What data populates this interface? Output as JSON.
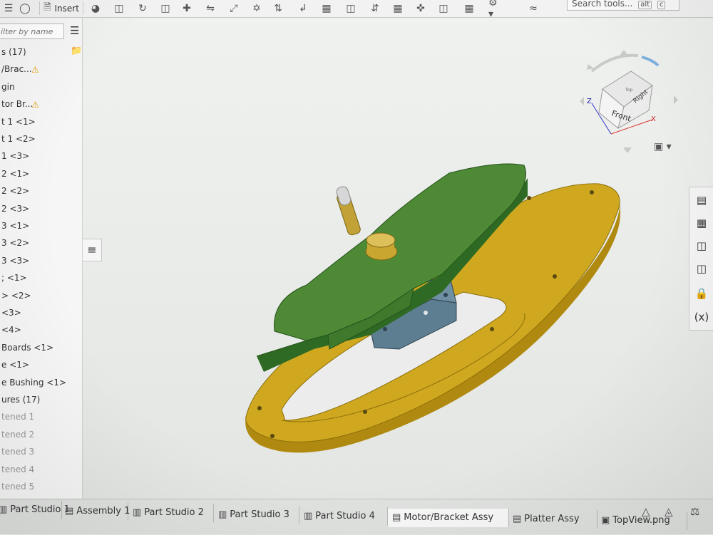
{
  "toolbar": {
    "insert_label": "Insert",
    "search_placeholder": "Search tools...",
    "search_shortcut_1": "alt",
    "search_shortcut_2": "c"
  },
  "left_panel": {
    "filter_placeholder": "ilter by name",
    "items": [
      {
        "label": "s (17)",
        "muted": false
      },
      {
        "label": "/Brac...",
        "muted": false,
        "warning": true
      },
      {
        "label": "gin",
        "muted": false
      },
      {
        "label": "tor Br...",
        "muted": false,
        "warning": true
      },
      {
        "label": "t 1 <1>",
        "muted": false
      },
      {
        "label": "t 1 <2>",
        "muted": false
      },
      {
        "label": "1 <3>",
        "muted": false
      },
      {
        "label": " 2 <1>",
        "muted": false
      },
      {
        "label": " 2 <2>",
        "muted": false
      },
      {
        "label": " 2 <3>",
        "muted": false
      },
      {
        "label": " 3 <1>",
        "muted": false
      },
      {
        "label": "3 <2>",
        "muted": false
      },
      {
        "label": "3 <3>",
        "muted": false
      },
      {
        "label": "; <1>",
        "muted": false
      },
      {
        "label": "> <2>",
        "muted": false
      },
      {
        "label": " <3>",
        "muted": false
      },
      {
        "label": " <4>",
        "muted": false
      },
      {
        "label": " Boards <1>",
        "muted": false
      },
      {
        "label": "e <1>",
        "muted": false
      },
      {
        "label": "e Bushing <1>",
        "muted": false
      },
      {
        "label": "ures (17)",
        "muted": false
      },
      {
        "label": "tened 1",
        "muted": true
      },
      {
        "label": "tened 2",
        "muted": true
      },
      {
        "label": "tened 3",
        "muted": true
      },
      {
        "label": "tened 4",
        "muted": true
      },
      {
        "label": "tened 5",
        "muted": true
      }
    ]
  },
  "viewcube": {
    "front_label": "Front",
    "right_label": "Right",
    "top_label": "Top",
    "axis_x": "X",
    "axis_z": "Z"
  },
  "tabs": [
    {
      "label": "Part Studio 1",
      "icon": "part-studio-icon",
      "active": false
    },
    {
      "label": "Assembly 1",
      "icon": "assembly-icon",
      "active": false
    },
    {
      "label": "Part Studio 2",
      "icon": "part-studio-icon",
      "active": false
    },
    {
      "label": "Part Studio 3",
      "icon": "part-studio-icon",
      "active": false
    },
    {
      "label": "Part Studio 4",
      "icon": "part-studio-icon",
      "active": false
    },
    {
      "label": "Motor/Bracket Assy",
      "icon": "assembly-icon",
      "active": true
    },
    {
      "label": "Platter Assy",
      "icon": "assembly-icon",
      "active": false
    },
    {
      "label": "TopView.png",
      "icon": "image-icon",
      "active": false
    }
  ],
  "colors": {
    "platter_green": "#3f7f2e",
    "base_gold": "#c9a219",
    "bracket_blue": "#4f6f82",
    "shaft_gold": "#c2a136",
    "accent_blue": "#2d6db5"
  }
}
